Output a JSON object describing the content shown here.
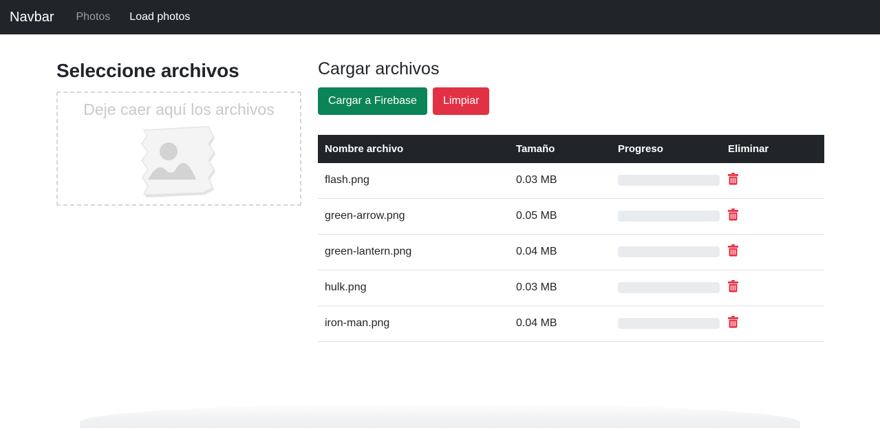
{
  "navbar": {
    "brand": "Navbar",
    "links": [
      {
        "label": "Photos",
        "active": false
      },
      {
        "label": "Load photos",
        "active": true
      }
    ]
  },
  "select_panel": {
    "title": "Seleccione archivos",
    "dropzone_text": "Deje caer aquí los archivos",
    "placeholder_icon": "image-placeholder-icon"
  },
  "upload_panel": {
    "title": "Cargar archivos",
    "upload_button": "Cargar a Firebase",
    "clear_button": "Limpiar"
  },
  "table": {
    "headers": {
      "name": "Nombre archivo",
      "size": "Tamaño",
      "progress": "Progreso",
      "delete": "Eliminar"
    },
    "rows": [
      {
        "name": "flash.png",
        "size": "0.03 MB",
        "progress": 0,
        "delete_icon": "trash-icon"
      },
      {
        "name": "green-arrow.png",
        "size": "0.05 MB",
        "progress": 0,
        "delete_icon": "trash-icon"
      },
      {
        "name": "green-lantern.png",
        "size": "0.04 MB",
        "progress": 0,
        "delete_icon": "trash-icon"
      },
      {
        "name": "hulk.png",
        "size": "0.03 MB",
        "progress": 0,
        "delete_icon": "trash-icon"
      },
      {
        "name": "iron-man.png",
        "size": "0.04 MB",
        "progress": 0,
        "delete_icon": "trash-icon"
      }
    ]
  },
  "colors": {
    "navbar_bg": "#212529",
    "table_header_bg": "#212529",
    "upload_green": "#0b8457",
    "clear_red": "#e23144",
    "trash_red": "#e8283f",
    "progress_track": "#e9ecef",
    "dropzone_border": "#d6d6d6",
    "dropzone_text": "#c9c9c9"
  }
}
